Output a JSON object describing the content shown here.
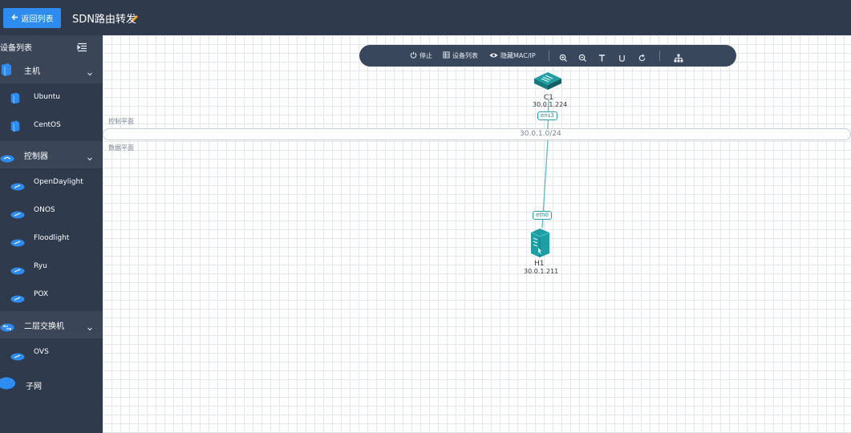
{
  "header": {
    "back_label": "返回列表",
    "title": "SDN路由转发"
  },
  "sidebar": {
    "title": "设备列表",
    "groups": [
      {
        "label": "主机",
        "items": [
          "Ubuntu",
          "CentOS"
        ]
      },
      {
        "label": "控制器",
        "items": [
          "OpenDaylight",
          "ONOS",
          "Floodlight",
          "Ryu",
          "POX"
        ]
      },
      {
        "label": "二层交换机",
        "items": [
          "OVS"
        ]
      }
    ],
    "subnet_label": "子网"
  },
  "toolbar": {
    "stop_label": "停止",
    "device_list_label": "设备列表",
    "hide_mac_ip_label": "隐藏MAC/IP"
  },
  "canvas": {
    "control_plane_label": "控制平面",
    "data_plane_label": "数据平面",
    "subnet_cidr": "30.0.1.0/24",
    "nodes": {
      "controller": {
        "name": "C1",
        "ip": "30.0.1.224",
        "port": "ens3"
      },
      "host": {
        "name": "H1",
        "ip": "30.0.1.211",
        "port": "eth0"
      }
    }
  },
  "colors": {
    "dark_bar": "#2f3a4c",
    "accent_blue": "#2e8cf0",
    "teal": "#1f9ea4",
    "grid": "#e4e7ec"
  }
}
